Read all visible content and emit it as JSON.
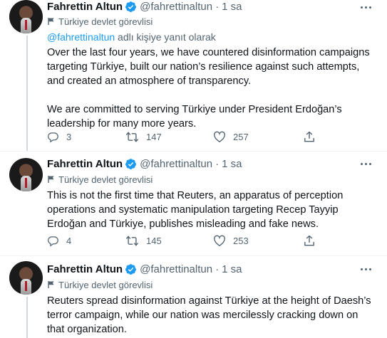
{
  "tweets": [
    {
      "name": "Fahrettin Altun",
      "handle": "@fahrettinaltun",
      "time": "1 sa",
      "label": "Türkiye devlet görevlisi",
      "reply_mention": "@fahrettinaltun",
      "reply_suffix": "adlı kişiye yanıt olarak",
      "paragraphs": [
        "Over the last four years, we have countered disinformation campaigns targeting Türkiye, built our nation’s resilience against such attempts, and created an atmosphere of transparency.",
        "We are committed to serving Türkiye under President Erdoğan’s leadership for many more years."
      ],
      "replies": "3",
      "retweets": "147",
      "likes": "257"
    },
    {
      "name": "Fahrettin Altun",
      "handle": "@fahrettinaltun",
      "time": "1 sa",
      "label": "Türkiye devlet görevlisi",
      "paragraphs": [
        "This is not the first time that Reuters, an apparatus of perception operations and systematic manipulation targeting Recep Tayyip Erdoğan and Türkiye, publishes misleading and fake news."
      ],
      "replies": "4",
      "retweets": "145",
      "likes": "253"
    },
    {
      "name": "Fahrettin Altun",
      "handle": "@fahrettinaltun",
      "time": "1 sa",
      "label": "Türkiye devlet görevlisi",
      "paragraphs": [
        "Reuters spread disinformation against Türkiye at the height of Daesh’s terror campaign, while our nation was mercilessly cracking down on that organization."
      ]
    }
  ],
  "icons": {
    "verified": "verified-badge-icon",
    "label": "flag-icon",
    "reply": "reply-icon",
    "retweet": "retweet-icon",
    "like": "like-icon",
    "share": "share-icon",
    "more": "more-icon"
  },
  "colors": {
    "accent": "#1d9bf0",
    "secondary_text": "#536471",
    "divider": "#eff3f4"
  }
}
